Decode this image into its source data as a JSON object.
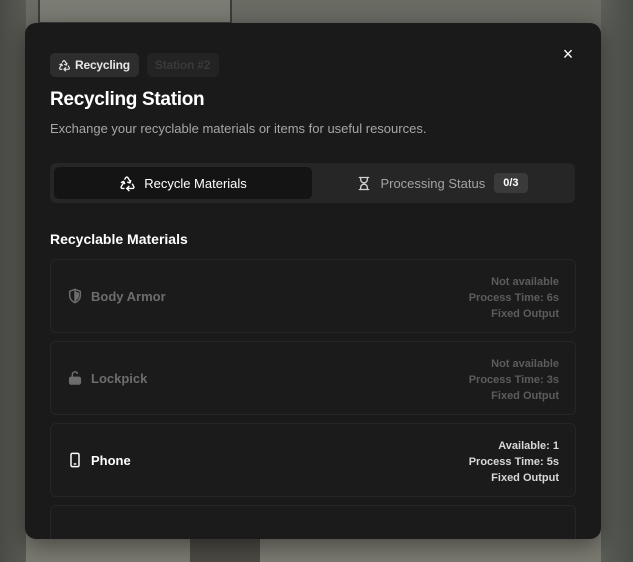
{
  "chips": {
    "primary": "Recycling",
    "secondary": "Station #2"
  },
  "title": "Recycling Station",
  "subtitle": "Exchange your recyclable materials or items for useful resources.",
  "close_label": "×",
  "tabs": {
    "recycle": "Recycle Materials",
    "processing": "Processing Status",
    "processing_count": "0/3"
  },
  "section_title": "Recyclable Materials",
  "items": [
    {
      "name": "Body Armor",
      "icon": "shield-icon",
      "availability": "Not available",
      "process_time": "Process Time: 6s",
      "output": "Fixed Output"
    },
    {
      "name": "Lockpick",
      "icon": "unlock-icon",
      "availability": "Not available",
      "process_time": "Process Time: 3s",
      "output": "Fixed Output"
    },
    {
      "name": "Phone",
      "icon": "phone-icon",
      "availability": "Available: 1",
      "process_time": "Process Time: 5s",
      "output": "Fixed Output"
    }
  ],
  "colors": {
    "panel": "#1a1a1a",
    "card_border": "#262626",
    "text_primary": "#ffffff",
    "text_muted": "#6d6d6d"
  }
}
